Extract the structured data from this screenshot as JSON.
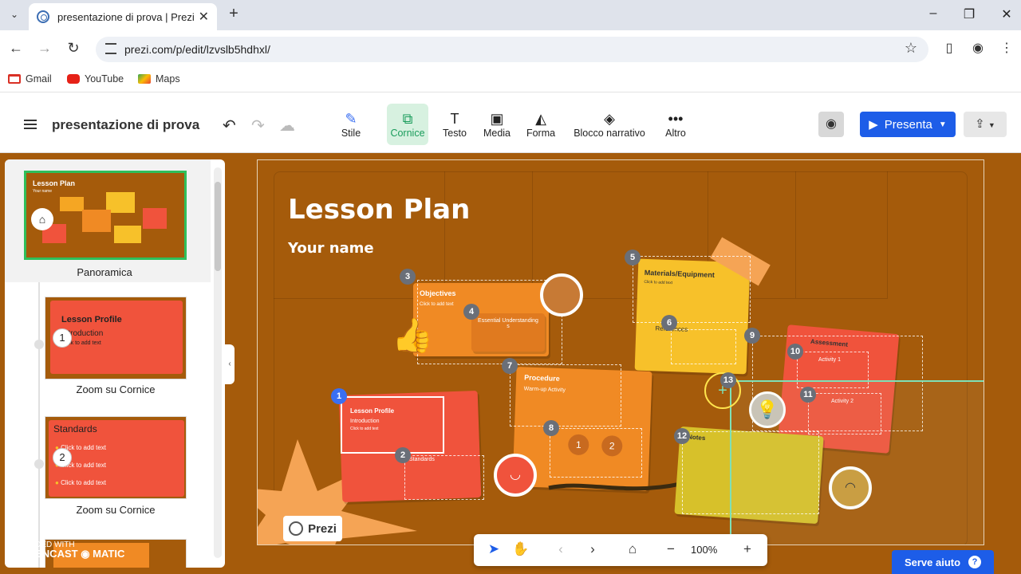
{
  "browser": {
    "tab_title": "presentazione di prova | Prezi",
    "url": "prezi.com/p/edit/lzvslb5hdhxl/",
    "bookmarks": [
      "Gmail",
      "YouTube",
      "Maps"
    ]
  },
  "toolbar": {
    "doc_title": "presentazione di prova",
    "tools": [
      "Stile",
      "Cornice",
      "Testo",
      "Media",
      "Forma",
      "Blocco narrativo",
      "Altro"
    ],
    "present_label": "Presenta"
  },
  "sidebar": {
    "overview_label": "Panoramica",
    "overview_title": "Lesson Plan",
    "overview_sub": "Your name",
    "steps": [
      {
        "num": "1",
        "label": "Zoom su Cornice",
        "title": "Lesson Profile",
        "sub": "Introduction",
        "text": "Click to add text"
      },
      {
        "num": "2",
        "label": "Zoom su Cornice",
        "title": "Standards",
        "items": [
          "Click to add text",
          "Click to add text",
          "Click to add text"
        ]
      }
    ]
  },
  "canvas": {
    "title": "Lesson Plan",
    "subtitle": "Your name",
    "logo": "Prezi",
    "cards": {
      "objectives": "Objectives",
      "essential": "Essential Understanding s",
      "materials": "Materials/Equipment",
      "references": "References",
      "procedure": "Procedure",
      "warmup": "Warm-up Activity",
      "assessment": "Assessment",
      "activity1": "Activity 1",
      "activity2": "Activity 2",
      "notes": "Notes",
      "lesson_profile": "Lesson Profile",
      "introduction": "Introduction",
      "standards": "Standards",
      "click_text": "Click to add text"
    },
    "badges": [
      "1",
      "2",
      "3",
      "4",
      "5",
      "6",
      "7",
      "8",
      "9",
      "10",
      "11",
      "12",
      "13"
    ]
  },
  "bottom": {
    "zoom": "100%"
  },
  "help_label": "Serve aiuto",
  "watermark": {
    "line1": "RECORDED WITH",
    "line2": "SCREENCAST",
    "line3": "MATIC"
  }
}
